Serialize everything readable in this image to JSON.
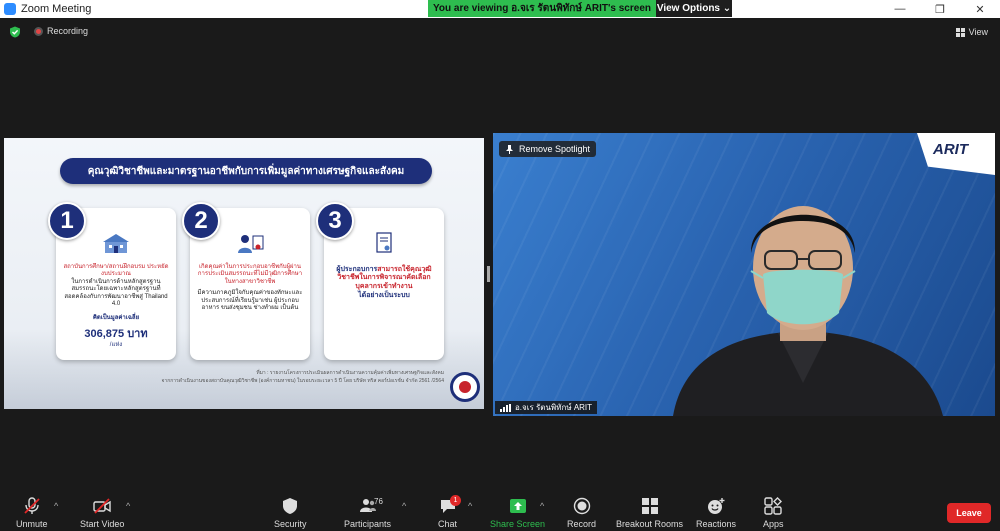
{
  "window": {
    "title": "Zoom Meeting",
    "controls": [
      "—",
      "❐",
      "✕"
    ]
  },
  "banner": {
    "viewing_text": "You are viewing อ.จเร รัตนพิทักษ์ ARIT's screen",
    "view_options": "View Options ⌄"
  },
  "top": {
    "recording": "Recording",
    "view": "View"
  },
  "slide": {
    "title": "คุณวุฒิวิชาชีพและมาตรฐานอาชีพกับการเพิ่มมูลค่าทางเศรษฐกิจและสังคม",
    "cards": [
      {
        "number": "1",
        "line_red": "สถาบันการศึกษา/สถานฝึกอบรม ประหยัดงบประมาณ",
        "line_body": "ในการดำเนินการด้านหลักสูตรฐานสมรรถนะโดยเฉพาะหลักสูตรฐานที่สอดคล้องกับการพัฒนาอาชีพสู่ Thailand 4.0",
        "value_label": "คิดเป็นมูลค่าเฉลี่ย",
        "value": "306,875 บาท",
        "value_unit": "/แห่ง"
      },
      {
        "number": "2",
        "line_red": "เกิดคุณค่าในการประกอบอาชีพกับผู้ผ่านการประเมินสมรรถนะที่ไม่มีวุฒิการศึกษาในทางสาขาวิชาชีพ",
        "line_body": "มีความภาคภูมิใจกับคุณค่าของทักษะและประสบการณ์ที่เรียนรู้มาเช่น ผู้ประกอบอาหาร ขนส่งชุมชน ช่างทำผม เป็นต้น"
      },
      {
        "number": "3",
        "line_navy_1": "ผู้ประกอบการ",
        "line_red_1": "สามารถใช้คุณวุฒิวิชาชีพในการพิจารณาคัดเลือกบุคลากรเข้าทำงาน",
        "line_navy_2": "ได้อย่างเป็นระบบ"
      }
    ],
    "source_line1": "ที่มา : รายงานโครงการประเมินผลการดำเนินงานความคุ้มค่าเพิ่มทางเศรษฐกิจและสังคม",
    "source_line2": "จากการดำเนินงานของสถาบันคุณวุฒิวิชาชีพ (องค์การมหาชน) ในรอบระยะเวลา 5 ปี โดย บริษัท ทริส คอร์ปอเรชั่น จำกัด 2561 /2564"
  },
  "video": {
    "spotlight": "Remove Spotlight",
    "brand": "ARIT",
    "name": "อ.จเร รัตนพิทักษ์  ARIT"
  },
  "toolbar": {
    "unmute": "Unmute",
    "start_video": "Start Video",
    "security": "Security",
    "participants": "Participants",
    "participant_count": "76",
    "chat": "Chat",
    "chat_badge": "1",
    "share_screen": "Share Screen",
    "record": "Record",
    "breakout_rooms": "Breakout Rooms",
    "reactions": "Reactions",
    "apps": "Apps",
    "leave": "Leave"
  }
}
